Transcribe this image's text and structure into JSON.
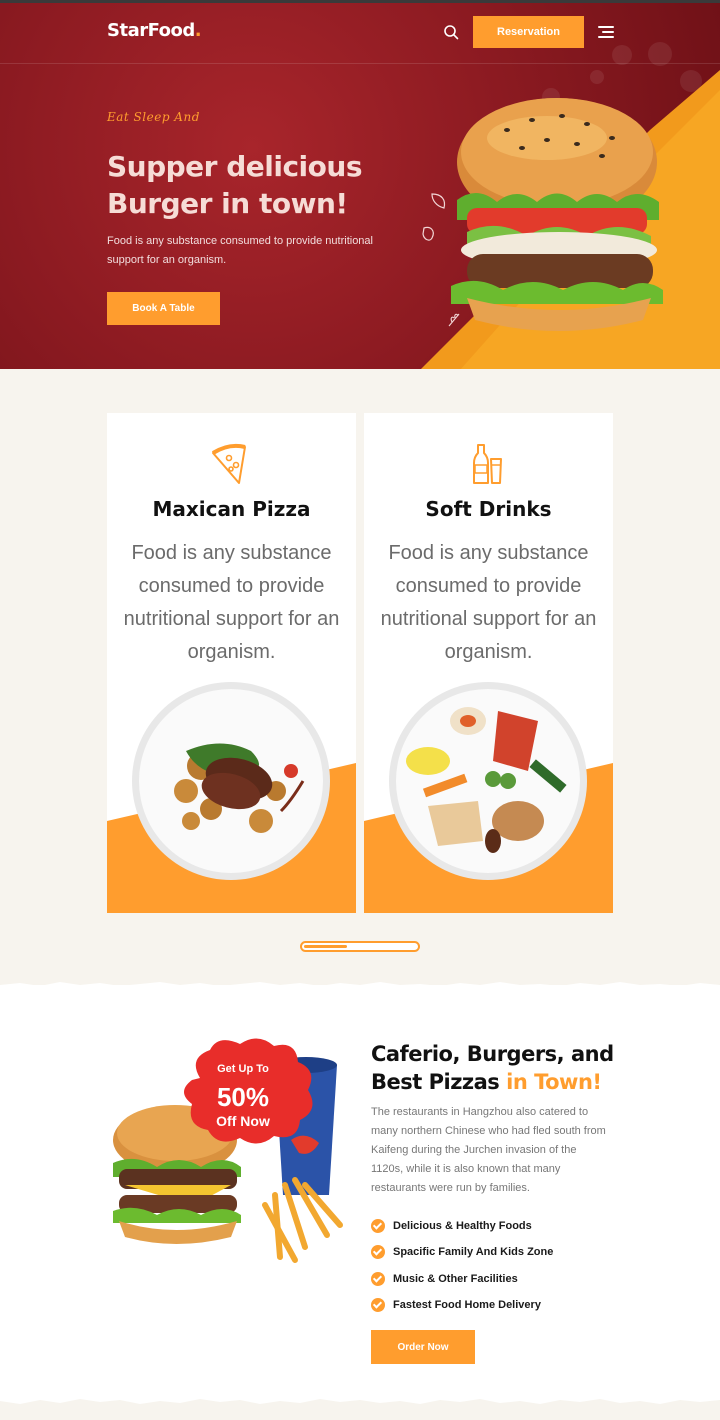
{
  "header": {
    "logo_text": "StarFood",
    "logo_dot": ".",
    "reservation_label": "Reservation"
  },
  "hero": {
    "tagline": "Eat Sleep And",
    "title": "Supper delicious Burger in town!",
    "description": "Food is any substance consumed to provide nutritional support for an organism.",
    "cta_label": "Book A Table"
  },
  "cards": [
    {
      "title": "Maxican Pizza",
      "text": "Food is any substance consumed to provide nutritional support for an organism.",
      "icon": "pizza-slice-icon"
    },
    {
      "title": "Soft Drinks",
      "text": "Food is any substance consumed to provide nutritional support for an organism.",
      "icon": "drinks-icon"
    }
  ],
  "slider": {
    "progress": 0.38
  },
  "promo": {
    "badge_line1": "Get Up To",
    "badge_line2": "50%",
    "badge_line3": "Off Now",
    "title_main": "Caferio, Burgers, and Best Pizzas ",
    "title_highlight": "in Town!",
    "description": "The restaurants in Hangzhou also catered to many northern Chinese who had fled south from Kaifeng during the Jurchen invasion of the 1120s, while it is also known that many restaurants were run by families.",
    "features": [
      "Delicious & Healthy Foods",
      "Spacific Family And Kids Zone",
      "Music & Other Facilities",
      "Fastest Food Home Delivery"
    ],
    "cta_label": "Order Now"
  },
  "colors": {
    "accent": "#ff9d2e",
    "hero_red": "#8e1b22",
    "cream": "#f7f4ee"
  }
}
